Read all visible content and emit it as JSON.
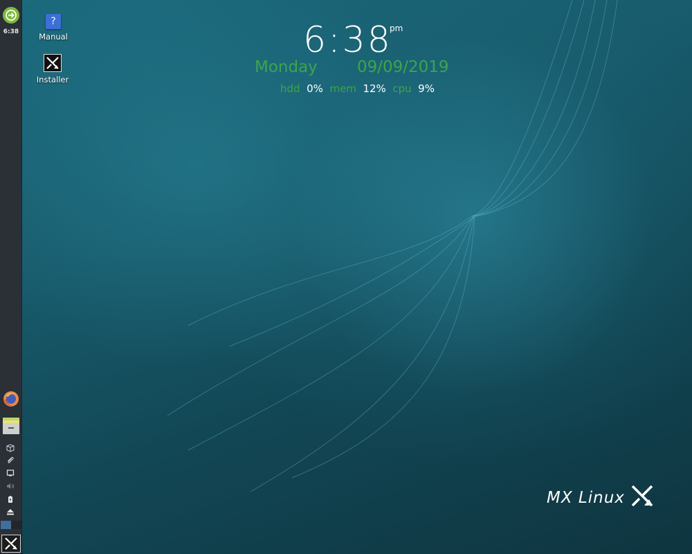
{
  "panel": {
    "clock": "6:38",
    "menu_icon": "circle-arrow-icon",
    "launchers": [
      {
        "name": "Firefox",
        "icon": "firefox-icon"
      },
      {
        "name": "File Manager",
        "icon": "file-manager-icon"
      }
    ],
    "tray": [
      "package-icon",
      "paperclip-icon",
      "display-icon",
      "volume-icon",
      "battery-icon",
      "eject-icon"
    ],
    "workspaces": {
      "count": 2,
      "active": 1
    },
    "bottom_icon": "mx-logo-icon"
  },
  "desktop": {
    "icons": [
      {
        "label": "Manual",
        "icon": "help-book-icon",
        "glyph": "?"
      },
      {
        "label": "Installer",
        "icon": "mx-installer-icon"
      }
    ]
  },
  "conky": {
    "time": "6:38",
    "ampm": "pm",
    "day": "Monday",
    "date": "09/09/2019",
    "stats": [
      {
        "key": "hdd",
        "value": "0%"
      },
      {
        "key": "mem",
        "value": "12%"
      },
      {
        "key": "cpu",
        "value": "9%"
      }
    ],
    "accent_color": "#3ca646"
  },
  "brand": {
    "text": "MX Linux"
  }
}
